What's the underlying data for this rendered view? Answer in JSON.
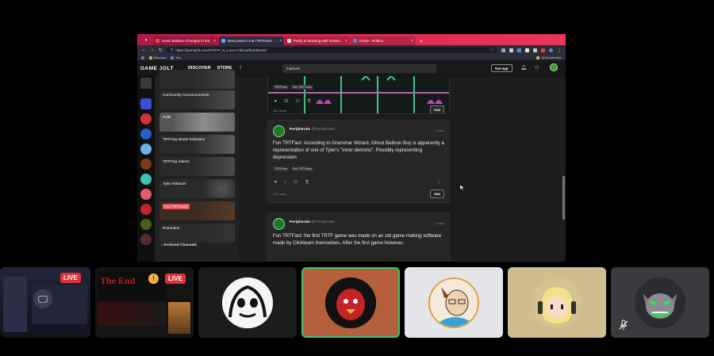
{
  "browser": {
    "tabs": [
      {
        "title": "Sonic Balance Changes in the...",
        "fav_color": "#e24a4a"
      },
      {
        "title": "New posts in Fun TRTFacts - ...",
        "fav_color": "#6aa0ff"
      },
      {
        "title": "Partly & Stocking with Garten...",
        "fav_color": "#d9d9d9"
      },
      {
        "title": "Home - Roblox",
        "fav_color": "#4b8ed6"
      }
    ],
    "new_tab": "+",
    "url": "https://gamejolt.com/c/TRTF_N_Lover-Fdsma/funtrtfacts#",
    "bookmarks": [
      "Discover",
      "Yes"
    ],
    "all_bookmarks": "All Bookmarks"
  },
  "site": {
    "logo": "GAME JOLT",
    "nav": [
      "DISCOVER",
      "STORE"
    ],
    "search_value": "fnaftears",
    "get_app": "Get App"
  },
  "channels": [
    {
      "label": "Community Announcements",
      "selected": false
    },
    {
      "label": "Polls",
      "selected": false
    },
    {
      "label": "TRTFing Model Releases",
      "selected": false
    },
    {
      "label": "TRTFing Videos",
      "selected": false
    },
    {
      "label": "Tyler Ahlstrom",
      "selected": false
    },
    {
      "label": "Fun TRTFacts",
      "selected": true
    },
    {
      "label": "Promotion",
      "selected": false
    }
  ],
  "archived_label": "Archived Channels",
  "posts": [
    {
      "tags": [
        "TRTFiers",
        "Fun TRTFacts"
      ],
      "likes": "12",
      "views": "180 views",
      "edit": "Edit"
    },
    {
      "user": "Peripherals",
      "handle": "@Peripherals",
      "time": "2 mins",
      "text": "Fun TRTFact: According to Grammar Wizard, Ghoul Balloon Boy is apparently a representation of one of Tyler's \"inner demons\". Possibly representing depression",
      "tags": [
        "TRTFiers",
        "Fun TRTFacts"
      ],
      "likes": "0",
      "views": "276 views",
      "edit": "Edit"
    },
    {
      "user": "Peripherals",
      "handle": "@Peripherals",
      "time": "2 mins",
      "text": "Fun TRTFact: the first TRTF game was made on an old game making software made by Clickteam themselves. After the first game however,"
    }
  ],
  "participants": {
    "live_label": "LIVE",
    "tile2_title": "The End",
    "warn": "!",
    "mute": "🎤"
  },
  "colors": {
    "tab_gradient_start": "#b0194a",
    "accent_red": "#e6535c",
    "gj_green": "#2fa12f",
    "speaking_border": "#3ec46d"
  }
}
